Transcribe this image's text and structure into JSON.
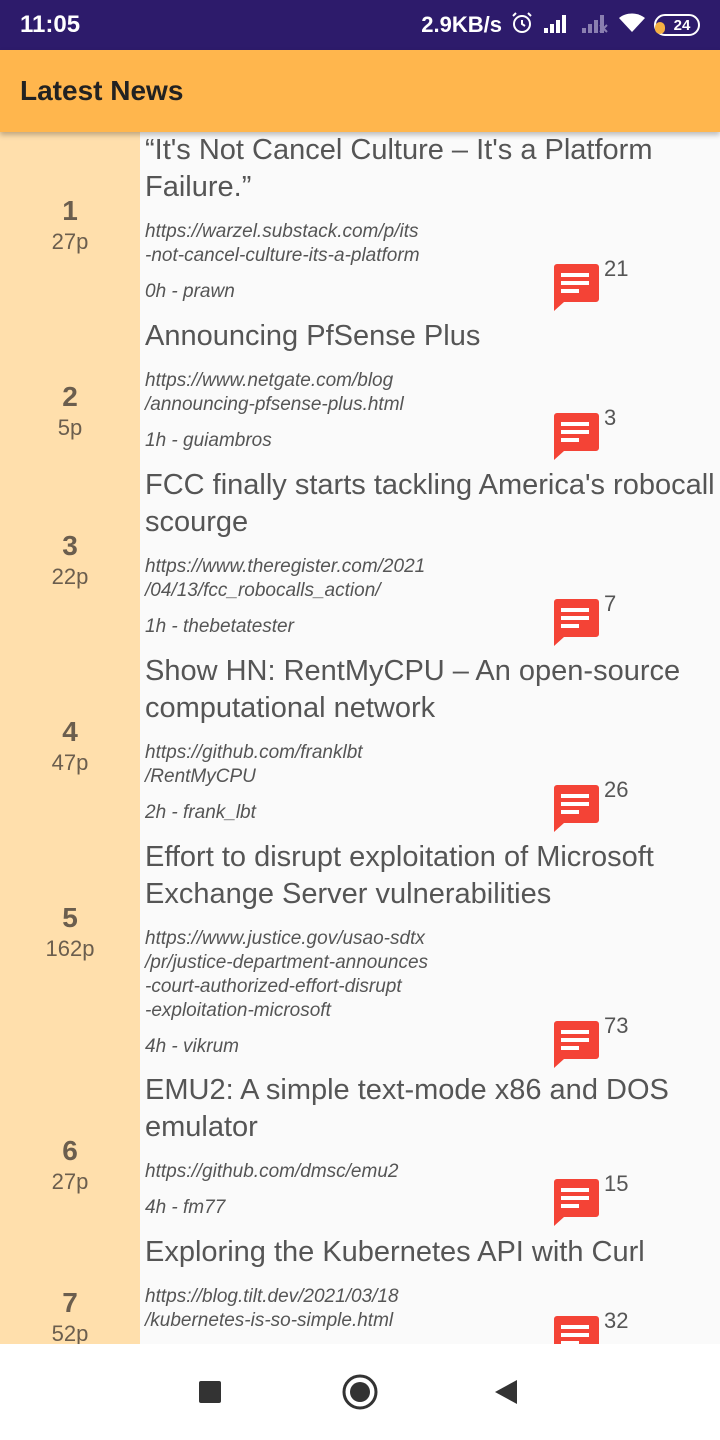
{
  "status_bar": {
    "time": "11:05",
    "speed": "2.9KB/s",
    "battery": "24",
    "icons": [
      "alarm-icon",
      "signal-icon",
      "signal-no-sim-icon",
      "wifi-icon",
      "battery-icon"
    ]
  },
  "app_bar": {
    "title": "Latest News"
  },
  "colors": {
    "status_bar": "#2d1b6b",
    "app_bar": "#ffb64d",
    "rank_column": "#ffdfac",
    "comment_icon": "#f44336"
  },
  "stories": [
    {
      "rank": "1",
      "points": "27p",
      "title": "“It's Not Cancel Culture – It's a Platform Failure.”",
      "url": "https://warzel.substack.com/p/its\n-not-cancel-culture-its-a-platform",
      "meta": "0h - prawn",
      "comments": "21"
    },
    {
      "rank": "2",
      "points": "5p",
      "title": "Announcing PfSense Plus",
      "url": "https://www.netgate.com/blog\n/announcing-pfsense-plus.html",
      "meta": "1h - guiambros",
      "comments": "3"
    },
    {
      "rank": "3",
      "points": "22p",
      "title": "FCC finally starts tackling America's robocall scourge",
      "url": "https://www.theregister.com/2021\n/04/13/fcc_robocalls_action/",
      "meta": "1h - thebetatester",
      "comments": "7"
    },
    {
      "rank": "4",
      "points": "47p",
      "title": "Show HN: RentMyCPU – An open-source computational network",
      "url": "https://github.com/franklbt\n/RentMyCPU",
      "meta": "2h - frank_lbt",
      "comments": "26"
    },
    {
      "rank": "5",
      "points": "162p",
      "title": "Effort to disrupt exploitation of Microsoft Exchange Server vulnerabilities",
      "url": "https://www.justice.gov/usao-sdtx\n/pr/justice-department-announces\n-court-authorized-effort-disrupt\n-exploitation-microsoft",
      "meta": "4h - vikrum",
      "comments": "73"
    },
    {
      "rank": "6",
      "points": "27p",
      "title": "EMU2: A simple text-mode x86 and DOS emulator",
      "url": "https://github.com/dmsc/emu2",
      "meta": "4h - fm77",
      "comments": "15"
    },
    {
      "rank": "7",
      "points": "52p",
      "title": "Exploring the Kubernetes API with Curl",
      "url": "https://blog.tilt.dev/2021/03/18\n/kubernetes-is-so-simple.html",
      "meta": "",
      "comments": "32"
    }
  ],
  "nav_bar": {
    "buttons": [
      "recents-button",
      "home-button",
      "back-button"
    ]
  }
}
